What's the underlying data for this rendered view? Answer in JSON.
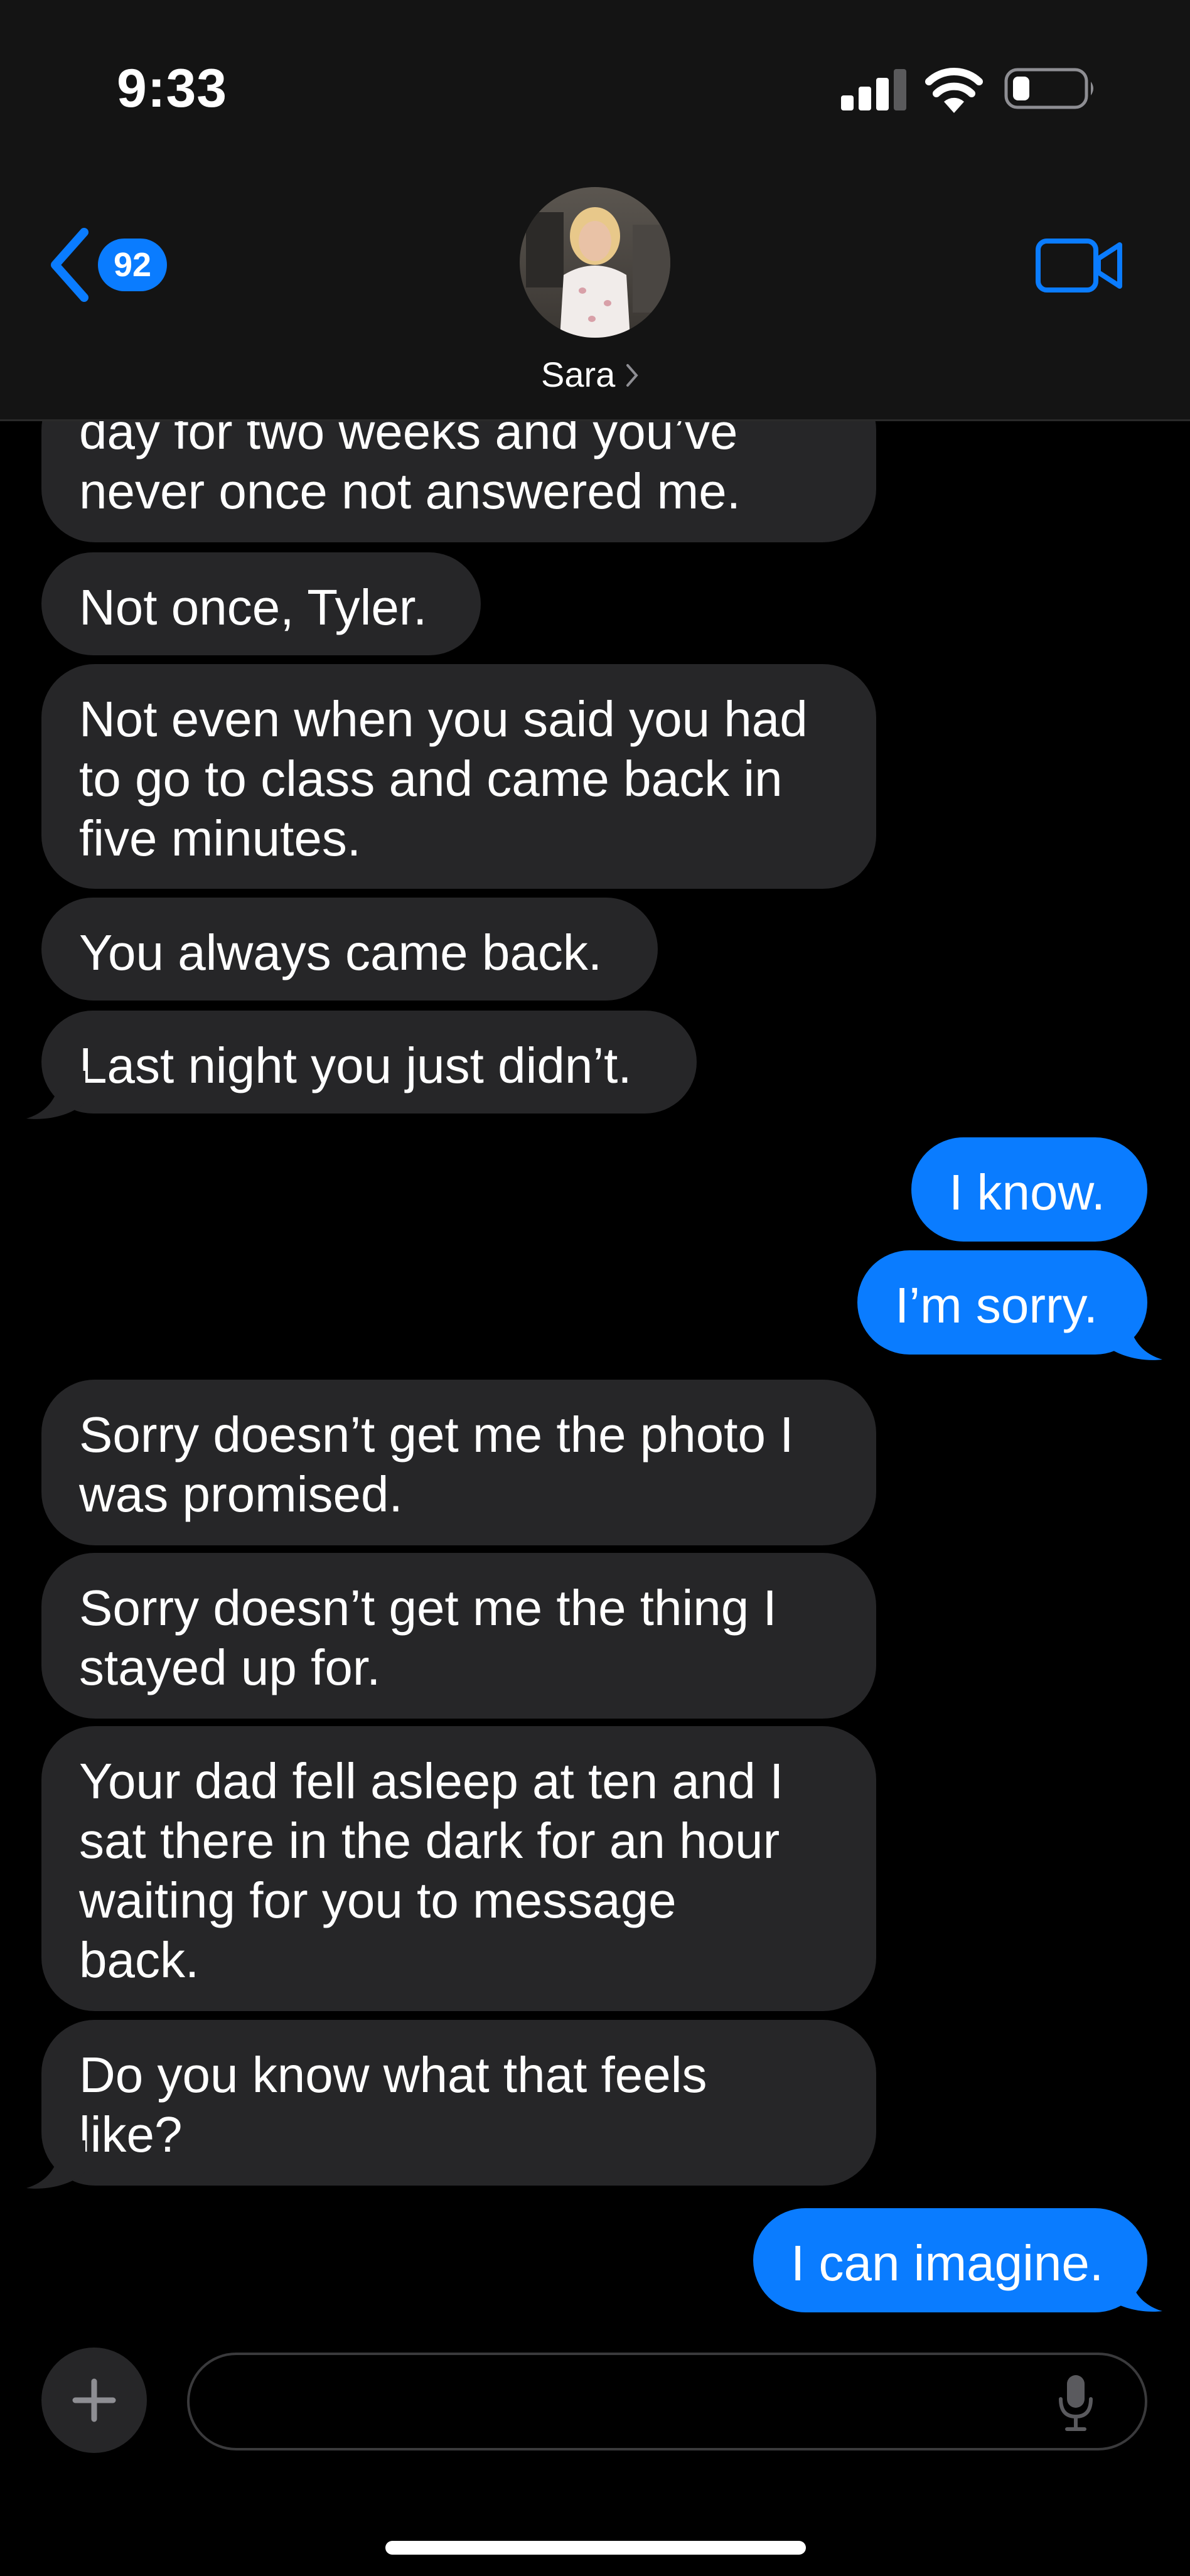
{
  "status_bar": {
    "time": "9:33"
  },
  "header": {
    "unread_count": "92",
    "contact_name": "Sara"
  },
  "messages": [
    {
      "from": "them",
      "text": "day for two weeks and you’ve\nnever once not answered me."
    },
    {
      "from": "them",
      "text": "Not once, Tyler."
    },
    {
      "from": "them",
      "text": "Not even when you said you had\nto go to class and came back in\nfive minutes."
    },
    {
      "from": "them",
      "text": "You always came back."
    },
    {
      "from": "them",
      "text": "Last night you just didn’t."
    },
    {
      "from": "me",
      "text": "I know."
    },
    {
      "from": "me",
      "text": "I’m sorry."
    },
    {
      "from": "them",
      "text": "Sorry doesn’t get me the photo I\nwas promised."
    },
    {
      "from": "them",
      "text": "Sorry doesn’t get me the thing I\nstayed up for."
    },
    {
      "from": "them",
      "text": "Your dad fell asleep at ten and I\nsat there in the dark for an hour\nwaiting for you to message\nback."
    },
    {
      "from": "them",
      "text": "Do you know what that feels\nlike?"
    },
    {
      "from": "me",
      "text": "I can imagine."
    }
  ],
  "composer": {
    "value": ""
  },
  "colors": {
    "sent_bubble": "#0a7cff",
    "received_bubble": "#262628",
    "header_bg": "#141414",
    "accent": "#0a7cff"
  },
  "icons": {
    "back": "chevron-left-icon",
    "video": "video-camera-icon",
    "plus": "plus-icon",
    "mic": "microphone-icon",
    "signal": "cellular-signal-icon",
    "wifi": "wifi-icon",
    "battery": "battery-icon"
  }
}
